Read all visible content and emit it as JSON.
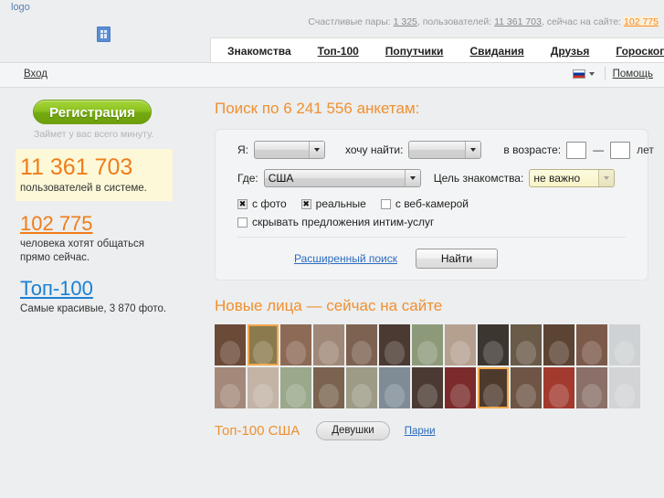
{
  "header": {
    "logo_text": "logo",
    "broken_image_icon": "broken-image-icon",
    "stats": {
      "couples_label": "Счастливые пары:",
      "couples_value": "1 325",
      "users_label": ", пользователей:",
      "users_value": "11 361 703",
      "online_label": ", сейчас на сайте:",
      "online_value": "102 775"
    },
    "nav": [
      {
        "label": "Знакомства"
      },
      {
        "label": "Топ-100"
      },
      {
        "label": "Попутчики"
      },
      {
        "label": "Свидания"
      },
      {
        "label": "Друзья"
      },
      {
        "label": "Гороскопы"
      }
    ]
  },
  "loginbar": {
    "login_label": "Вход",
    "language_icon": "russian-flag-icon",
    "help_label": "Помощь"
  },
  "sidebar": {
    "register_button": "Регистрация",
    "register_sub": "Займет у вас всего минуту.",
    "users_count": "11 361 703",
    "users_caption": "пользователей в системе.",
    "online_count": "102 775",
    "online_caption_line1": "человека хотят общаться",
    "online_caption_line2": "прямо сейчас.",
    "top100_link": "Топ-100",
    "top100_caption": "Самые красивые, 3 870 фото."
  },
  "search": {
    "title": "Поиск по 6 241 556 анкетам:",
    "me_label": "Я:",
    "me_value": "",
    "want_label": "хочу найти:",
    "want_value": "",
    "age_label": "в возрасте:",
    "age_from": "",
    "age_to": "",
    "age_dash": "—",
    "age_unit": "лет",
    "where_label": "Где:",
    "where_value": "США",
    "goal_label": "Цель знакомства:",
    "goal_value": "не важно",
    "checkboxes": [
      {
        "label": "с фото",
        "checked": true
      },
      {
        "label": "реальные",
        "checked": true
      },
      {
        "label": "с веб-камерой",
        "checked": false
      }
    ],
    "hide_intim_label": "скрывать предложения интим-услуг",
    "hide_intim_checked": false,
    "advanced_link": "Расширенный поиск",
    "find_button": "Найти"
  },
  "newfaces": {
    "title": "Новые лица — сейчас на сайте",
    "tiles": [
      {
        "color": "#6b4a38",
        "hl": false
      },
      {
        "color": "#8a7a4e",
        "hl": true
      },
      {
        "color": "#8d6a55",
        "hl": false
      },
      {
        "color": "#a08878",
        "hl": false
      },
      {
        "color": "#7d6251",
        "hl": false
      },
      {
        "color": "#4a3a32",
        "hl": false
      },
      {
        "color": "#8d9a7a",
        "hl": false
      },
      {
        "color": "#b5a090",
        "hl": false
      },
      {
        "color": "#3c3630",
        "hl": false
      },
      {
        "color": "#6a5a48",
        "hl": false
      },
      {
        "color": "#5c4434",
        "hl": false
      },
      {
        "color": "#7b5a4a",
        "hl": false
      },
      {
        "color": "#cfd2d4",
        "hl": false
      },
      {
        "color": "#a4897a",
        "hl": false
      },
      {
        "color": "#c3b4a6",
        "hl": false
      },
      {
        "color": "#9aa88c",
        "hl": false
      },
      {
        "color": "#7a6450",
        "hl": false
      },
      {
        "color": "#9d9a86",
        "hl": false
      },
      {
        "color": "#7f8c96",
        "hl": false
      },
      {
        "color": "#4b3a33",
        "hl": false
      },
      {
        "color": "#7b2b2b",
        "hl": false
      },
      {
        "color": "#4e3a2c",
        "hl": true
      },
      {
        "color": "#6e5546",
        "hl": false
      },
      {
        "color": "#a33a30",
        "hl": false
      },
      {
        "color": "#8a7068",
        "hl": false
      },
      {
        "color": "#d2d4d6",
        "hl": false
      }
    ]
  },
  "top100": {
    "title": "Топ-100 США",
    "girls_tab": "Девушки",
    "guys_tab": "Парни"
  }
}
